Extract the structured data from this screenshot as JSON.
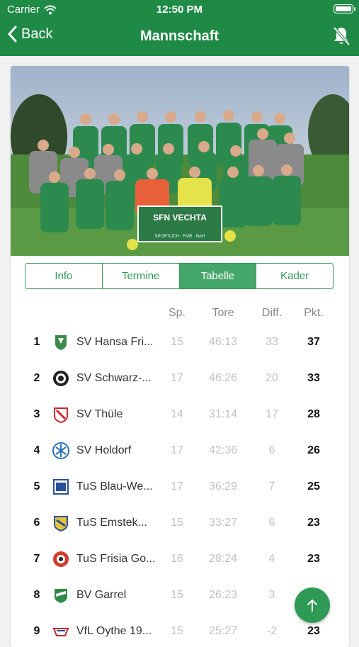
{
  "status": {
    "carrier": "Carrier",
    "time": "12:50 PM"
  },
  "nav": {
    "back_label": "Back",
    "title": "Mannschaft",
    "right_icon": "bell-slash-icon"
  },
  "photo": {
    "banner_text": "SFN VECHTA",
    "banner_subtext": "SPORTLICH · FAIR · NAH"
  },
  "tabs": [
    {
      "label": "Info",
      "active": false
    },
    {
      "label": "Termine",
      "active": false
    },
    {
      "label": "Tabelle",
      "active": true
    },
    {
      "label": "Kader",
      "active": false
    }
  ],
  "table": {
    "headers": {
      "sp": "Sp.",
      "tore": "Tore",
      "diff": "Diff.",
      "pkt": "Pkt."
    },
    "rows": [
      {
        "rank": "1",
        "team": "SV Hansa Fri...",
        "sp": "15",
        "tore": "46:13",
        "diff": "33",
        "pkt": "37"
      },
      {
        "rank": "2",
        "team": "SV Schwarz-...",
        "sp": "17",
        "tore": "46:26",
        "diff": "20",
        "pkt": "33"
      },
      {
        "rank": "3",
        "team": "SV Thüle",
        "sp": "14",
        "tore": "31:14",
        "diff": "17",
        "pkt": "28"
      },
      {
        "rank": "4",
        "team": "SV Holdorf",
        "sp": "17",
        "tore": "42:36",
        "diff": "6",
        "pkt": "26"
      },
      {
        "rank": "5",
        "team": "TuS Blau-We...",
        "sp": "17",
        "tore": "36:29",
        "diff": "7",
        "pkt": "25"
      },
      {
        "rank": "6",
        "team": "TuS Emstek...",
        "sp": "15",
        "tore": "33:27",
        "diff": "6",
        "pkt": "23"
      },
      {
        "rank": "7",
        "team": "TuS Frisia Go...",
        "sp": "16",
        "tore": "28:24",
        "diff": "4",
        "pkt": "23"
      },
      {
        "rank": "8",
        "team": "BV Garrel",
        "sp": "15",
        "tore": "26:23",
        "diff": "3",
        "pkt": ""
      },
      {
        "rank": "9",
        "team": "VfL Oythe 19...",
        "sp": "15",
        "tore": "25:27",
        "diff": "-2",
        "pkt": "23"
      }
    ]
  },
  "colors": {
    "brand_green": "#1f8a45",
    "tab_green": "#2f9a55",
    "active_tab": "#45a86a"
  },
  "fab": {
    "icon": "arrow-up-icon"
  }
}
